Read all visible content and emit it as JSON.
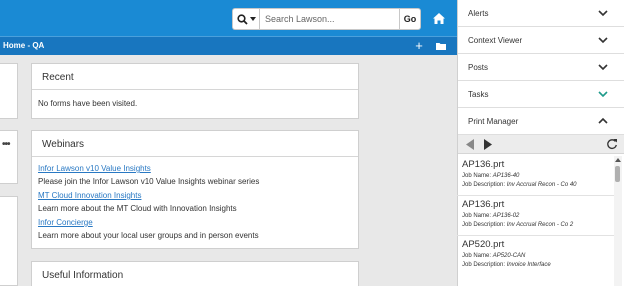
{
  "header": {
    "search_placeholder": "Search Lawson...",
    "go_label": "Go",
    "search_type_icon": "search-icon",
    "home_icon": "home-icon"
  },
  "breadcrumb": {
    "text": "Home - QA",
    "add_icon": "+",
    "folder_icon": "folder-icon"
  },
  "recent": {
    "title": "Recent",
    "empty_text": "No forms have been visited."
  },
  "webinars": {
    "title": "Webinars",
    "items": [
      {
        "link": "Infor Lawson v10 Value Insights",
        "desc": "Please join the Infor Lawson v10 Value Insights webinar series"
      },
      {
        "link": "MT Cloud Innovation Insights",
        "desc": "Learn more about the MT Cloud with Innovation Insights"
      },
      {
        "link": "Infor Concierge",
        "desc": "Learn more about your local user groups and in person events"
      }
    ]
  },
  "useful": {
    "title": "Useful Information"
  },
  "left_cards": {
    "ellipsis": "•••"
  },
  "panel": {
    "accordion": [
      {
        "label": "Alerts",
        "state": "collapsed"
      },
      {
        "label": "Context Viewer",
        "state": "collapsed"
      },
      {
        "label": "Posts",
        "state": "collapsed"
      },
      {
        "label": "Tasks",
        "state": "collapsed"
      },
      {
        "label": "Print Manager",
        "state": "expanded"
      }
    ],
    "jobs": [
      {
        "file": "AP136.prt",
        "name_label": "Job Name:",
        "name": "AP136-40",
        "desc_label": "Job Description:",
        "desc": "Inv Accrual Recon - Co 40"
      },
      {
        "file": "AP136.prt",
        "name_label": "Job Name:",
        "name": "AP136-02",
        "desc_label": "Job Description:",
        "desc": "Inv Accrual Recon - Co 2"
      },
      {
        "file": "AP520.prt",
        "name_label": "Job Name:",
        "name": "AP520-CAN",
        "desc_label": "Job Description:",
        "desc": "Invoice Interface"
      }
    ]
  },
  "colors": {
    "header_blue": "#1a8ad4",
    "breadcrumb_blue": "#1876bf",
    "link_blue": "#2878c3",
    "tasks_chevron": "#1e9a8a"
  }
}
